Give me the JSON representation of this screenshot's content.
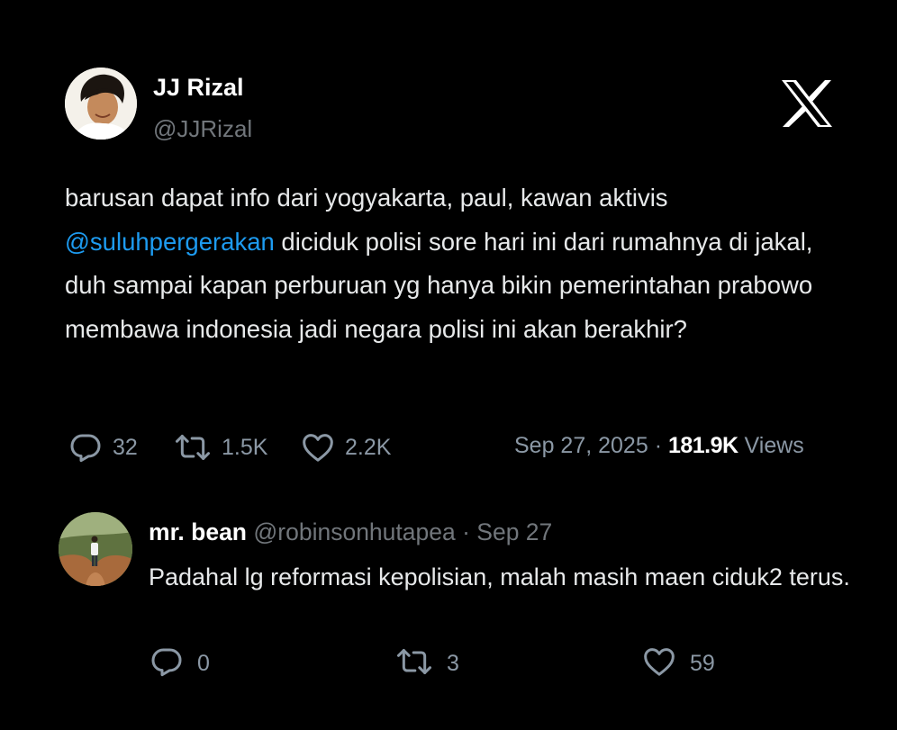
{
  "author": {
    "name": "JJ Rizal",
    "handle": "@JJRizal"
  },
  "brand": {
    "logo_icon": "x-logo-icon",
    "logo_color": "#ffffff"
  },
  "tweet": {
    "text_before_mention": "barusan dapat info dari yogyakarta, paul, kawan aktivis ",
    "mention": "@suluhpergerakan",
    "text_after_mention": " diciduk polisi sore hari ini dari rumahnya di jakal, duh sampai kapan perburuan yg hanya bikin pemerintahan prabowo membawa indonesia jadi negara polisi ini akan berakhir?",
    "mention_color": "#1d9bf0",
    "stats": {
      "replies": "32",
      "retweets": "1.5K",
      "likes": "2.2K"
    },
    "date": "Sep 27, 2025",
    "separator": " · ",
    "views_count": "181.9K",
    "views_label": " Views"
  },
  "reply": {
    "name": "mr. bean",
    "handle": "@robinsonhutapea",
    "separator": " · ",
    "date": "Sep 27",
    "text": "Padahal lg reformasi kepolisian, malah masih maen ciduk2 terus.",
    "stats": {
      "replies": "0",
      "retweets": "3",
      "likes": "59"
    }
  },
  "icons": {
    "reply": "reply-bubble-icon",
    "retweet": "retweet-arrows-icon",
    "like": "heart-icon"
  },
  "colors": {
    "background": "#000000",
    "primary_text": "#e7e9ea",
    "secondary_text": "#71767b"
  }
}
